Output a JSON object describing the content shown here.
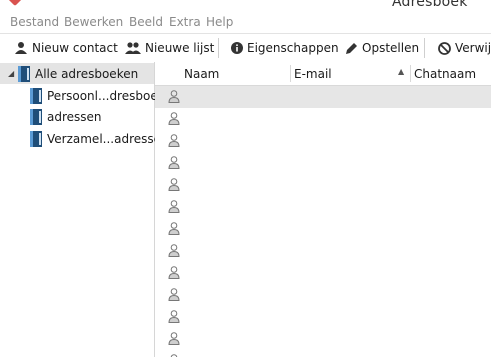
{
  "window": {
    "title": "Adresboek"
  },
  "menu": [
    "Bestand",
    "Bewerken",
    "Beeld",
    "Extra",
    "Help"
  ],
  "toolbar": {
    "new_contact": "Nieuw contact",
    "new_list": "Nieuwe lijst",
    "properties": "Eigenschappen",
    "compose": "Opstellen",
    "delete": "Verwijd"
  },
  "sidebar": {
    "root": "Alle adresboeken",
    "books": [
      "Persoonl...dresboek",
      "adressen",
      "Verzamel...adressen"
    ]
  },
  "columns": {
    "name": "Naam",
    "email": "E-mail",
    "chat": "Chatnaam",
    "sorted_column": "E-mail",
    "sort_direction": "ascending"
  },
  "contacts": {
    "visible_rows": 13,
    "selected_row": 1,
    "name_values": []
  },
  "colors": {
    "selection": "#e4e4e4",
    "menu_text": "#8a8a8a",
    "book_icon": "#1f4e79"
  },
  "icons": [
    "contact-icon",
    "list-icon",
    "info-icon",
    "pencil-icon",
    "delete-icon",
    "book-icon",
    "person-icon"
  ]
}
